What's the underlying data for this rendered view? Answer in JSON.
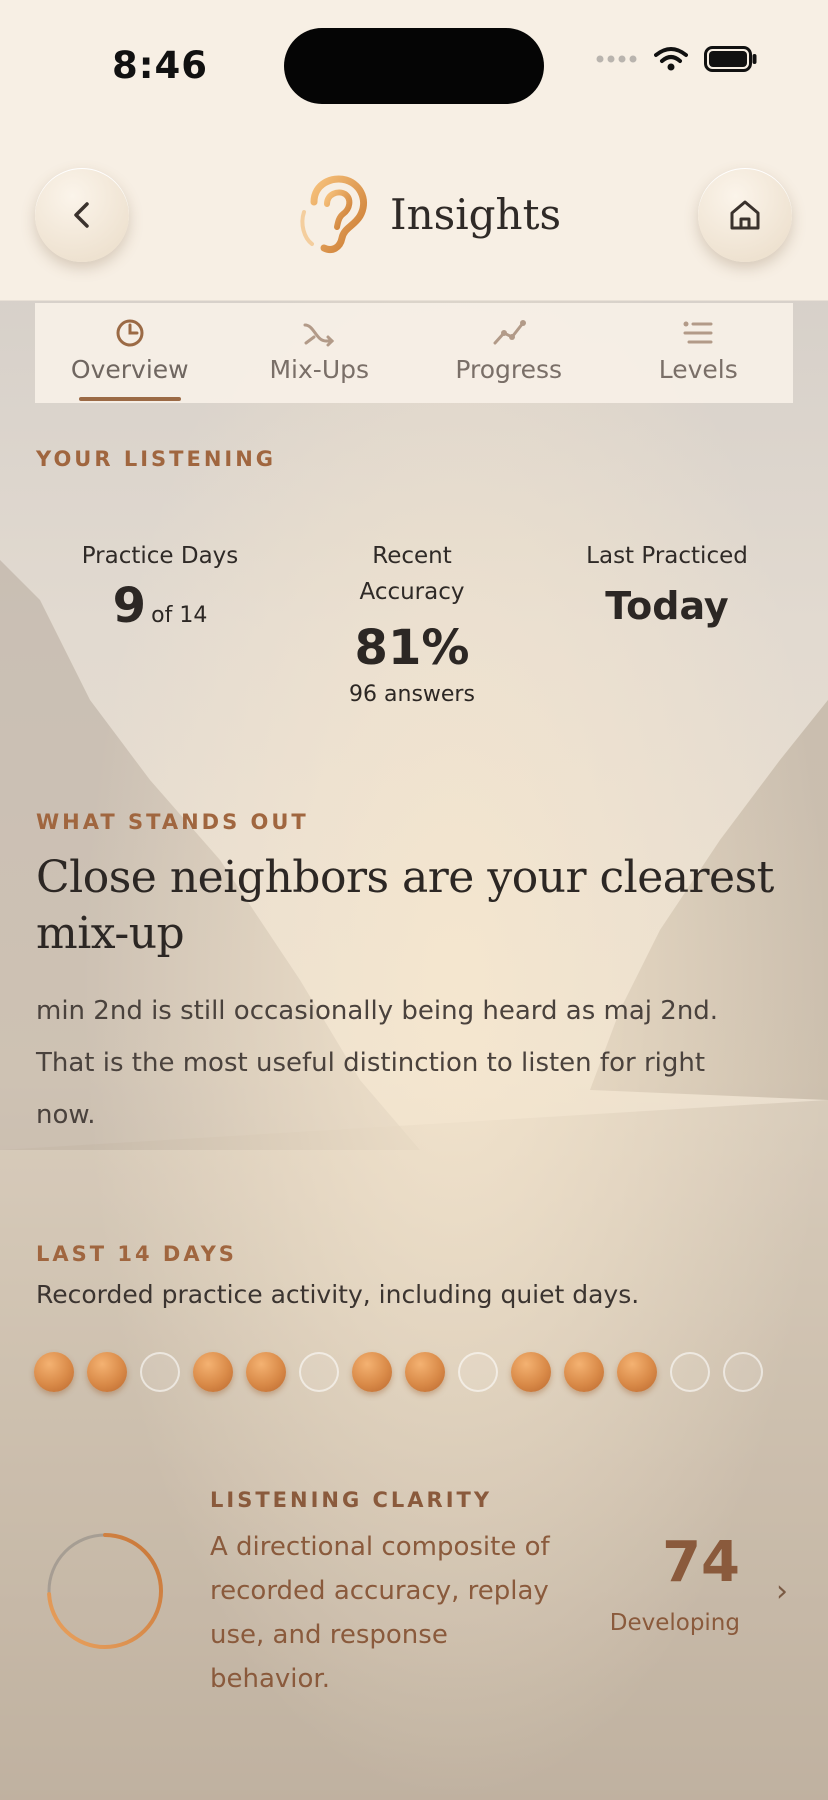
{
  "status": {
    "time": "8:46"
  },
  "nav": {
    "title": "Insights"
  },
  "tabs": [
    {
      "label": "Overview",
      "icon": "clock-pie-icon",
      "active": true
    },
    {
      "label": "Mix-Ups",
      "icon": "shuffle-icon",
      "active": false
    },
    {
      "label": "Progress",
      "icon": "trend-line-icon",
      "active": false
    },
    {
      "label": "Levels",
      "icon": "list-levels-icon",
      "active": false
    }
  ],
  "listening": {
    "section_label": "YOUR LISTENING",
    "practice_days": {
      "label": "Practice Days",
      "value": "9",
      "suffix": "of 14"
    },
    "accuracy": {
      "label_line1": "Recent",
      "label_line2": "Accuracy",
      "value": "81%",
      "sub": "96 answers"
    },
    "last_practiced": {
      "label": "Last Practiced",
      "value": "Today"
    }
  },
  "standout": {
    "section_label": "WHAT STANDS OUT",
    "headline_line1": "Close neighbors are your clearest",
    "headline_line2": "mix-up",
    "body_line1": "min 2nd is still occasionally being heard as maj 2nd.",
    "body_line2": "That is the most useful distinction to listen for right",
    "body_line3": "now."
  },
  "recent": {
    "section_label": "LAST 14 DAYS",
    "description": "Recorded practice activity, including quiet days.",
    "days": [
      true,
      true,
      false,
      true,
      true,
      false,
      true,
      true,
      false,
      true,
      true,
      true,
      false,
      false
    ]
  },
  "clarity": {
    "title": "LISTENING CLARITY",
    "desc_line1": "A directional composite of",
    "desc_line2": "recorded accuracy, replay",
    "desc_line3": "use, and response",
    "desc_line4": "behavior.",
    "score": "74",
    "level": 0.74,
    "status": "Developing"
  },
  "colors": {
    "accent": "#a0663f",
    "dot_on": "#d98a48",
    "nav_bg": "#f7efe4"
  }
}
